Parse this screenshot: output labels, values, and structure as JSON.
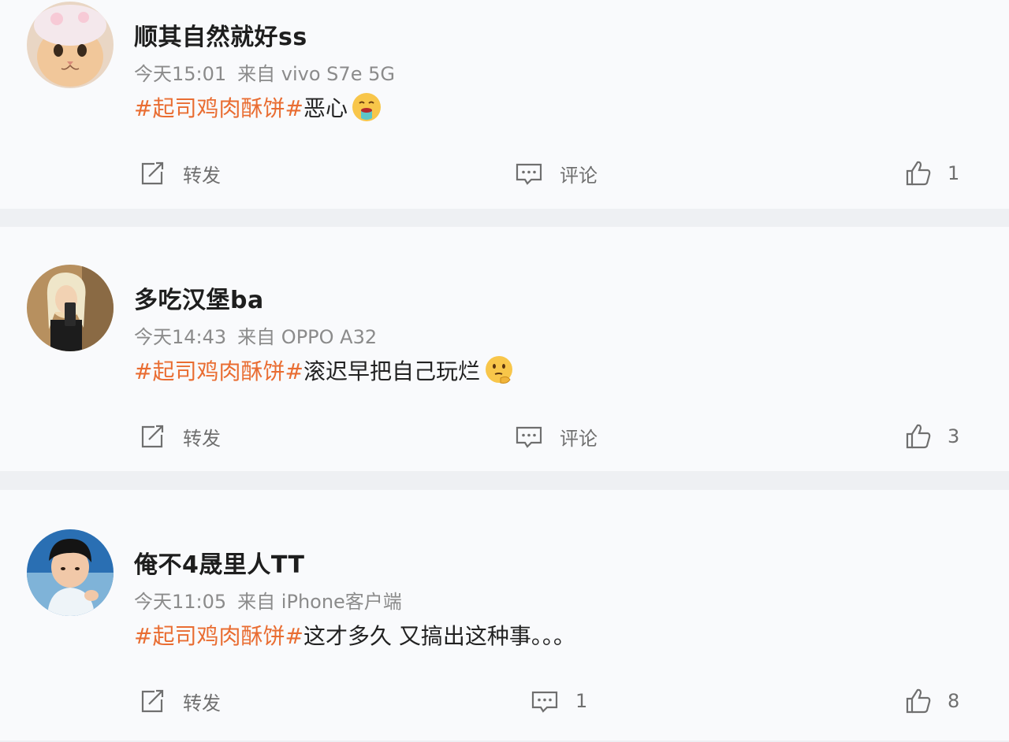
{
  "posts": [
    {
      "username": "顺其自然就好ss",
      "time": "今天15:01",
      "source": "来自 vivo S7e 5G",
      "hashtag": "#起司鸡肉酥饼#",
      "text": "恶心",
      "emoji": "vomiting-face-emoji",
      "avatar": "cat-avatar",
      "repost_label": "转发",
      "comment_label": "评论",
      "like_count": "1"
    },
    {
      "username": "多吃汉堡ba",
      "time": "今天14:43",
      "source": "来自 OPPO A32",
      "hashtag": "#起司鸡肉酥饼#",
      "text": "滚迟早把自己玩烂",
      "emoji": "thinking-face-emoji",
      "avatar": "girl-selfie-avatar",
      "repost_label": "转发",
      "comment_label": "评论",
      "like_count": "3"
    },
    {
      "username": "俺不4晟里人TT",
      "time": "今天11:05",
      "source": "来自 iPhone客户端",
      "hashtag": "#起司鸡肉酥饼#",
      "text": "这才多久 又搞出这种事。。。",
      "emoji": "",
      "avatar": "child-avatar",
      "repost_label": "转发",
      "comment_label": "1",
      "like_count": "8"
    }
  ],
  "colors": {
    "hashtag": "#e96d32",
    "background": "#f9fafc",
    "separator": "#eef0f3",
    "meta_text": "#8b8b8b"
  },
  "icons": [
    "repost-icon",
    "comment-icon",
    "thumbs-up-icon"
  ]
}
